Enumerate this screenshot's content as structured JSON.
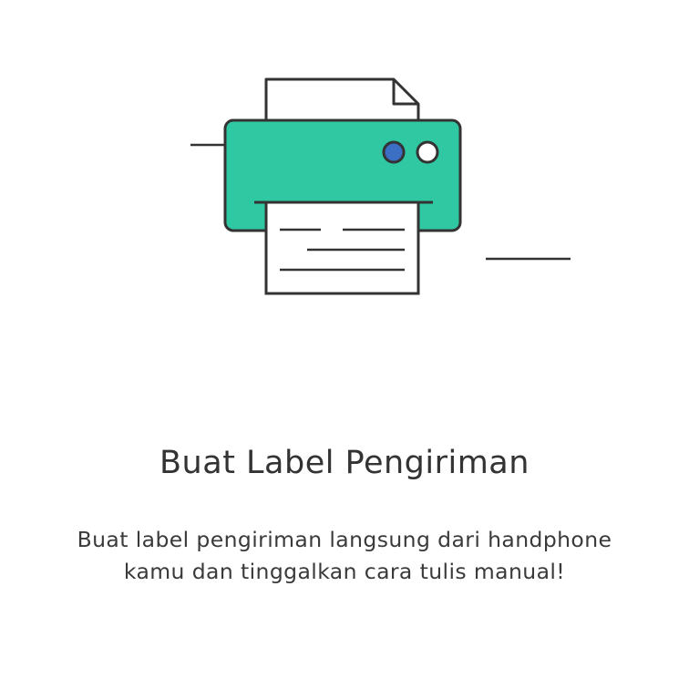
{
  "onboarding": {
    "illustration_icon": "printer-icon",
    "title": "Buat Label Pengiriman",
    "description": "Buat label pengiriman langsung dari handphone kamu dan tinggalkan cara tulis manual!"
  },
  "colors": {
    "printer_body": "#2FC8A3",
    "outline": "#333333",
    "button_blue": "#3A6FC4",
    "button_white": "#FFFFFF",
    "paper": "#FFFFFF"
  }
}
